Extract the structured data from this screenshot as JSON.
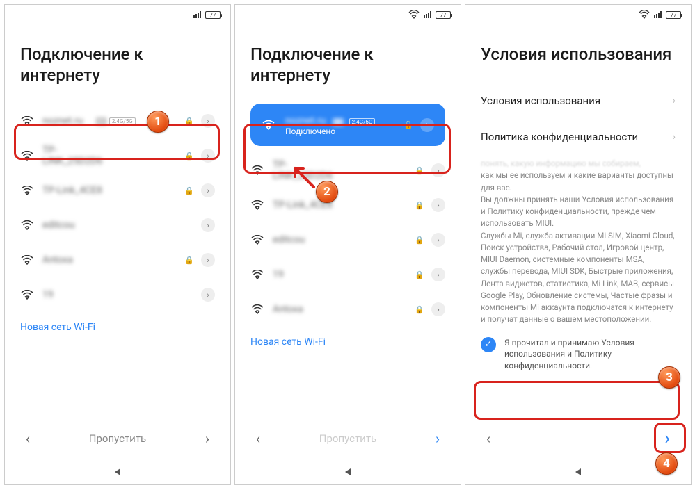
{
  "statusbar": {
    "battery": "77"
  },
  "screen1": {
    "title": "Подключение к интернету",
    "networks": [
      {
        "name": "noznet.ru",
        "mi": true,
        "band": "2.4G/5G",
        "locked": true
      },
      {
        "name": "TP-LINK_25D2D6",
        "locked": true
      },
      {
        "name": "TP-Link_4CE8",
        "locked": true
      },
      {
        "name": "editcou",
        "locked": false
      },
      {
        "name": "Antoxa",
        "locked": true
      },
      {
        "name": "19",
        "locked": false
      }
    ],
    "new_network": "Новая сеть Wi-Fi",
    "skip": "Пропустить"
  },
  "screen2": {
    "title": "Подключение к интернету",
    "selected": {
      "name": "noznet.ru",
      "status": "Подключено",
      "band": "2.4G/5G"
    },
    "networks": [
      {
        "name": "TP-LINK_25D2D6",
        "locked": true
      },
      {
        "name": "TP-Link_4CE8",
        "locked": true
      },
      {
        "name": "editcou",
        "locked": true
      },
      {
        "name": "19",
        "locked": true
      },
      {
        "name": "Antoxa",
        "locked": true
      }
    ],
    "new_network": "Новая сеть Wi-Fi",
    "skip": "Пропустить"
  },
  "screen3": {
    "title": "Условия использования",
    "row_terms": "Условия использования",
    "row_privacy": "Политика конфиденциальности",
    "policy_cut": "понять, какую информацию мы собираем,",
    "policy_body": "как мы ее используем и какие варианты доступны для вас.\nВы должны принять наши Условия использования и Политику конфиденциальности, прежде чем использовать MIUI.\nСлужбы Mi, служба активации Mi SIM, Xiaomi Cloud, Поиск устройства, Рабочий стол, Игровой центр, MIUI Daemon, системные компоненты MSA, службы перевода, MIUI SDK, Быстрые приложения, Лента виджетов, статистика, Mi Link, MAB, сервисы Google Play, Обновление системы, Частые фразы и компоненты Mi аккаунта подключатся к интернету и получат данные о вашем местоположении.",
    "agree": "Я прочитал и принимаю Условия использования и Политику конфиденциальности."
  },
  "steps": {
    "s1": "1",
    "s2": "2",
    "s3": "3",
    "s4": "4"
  }
}
